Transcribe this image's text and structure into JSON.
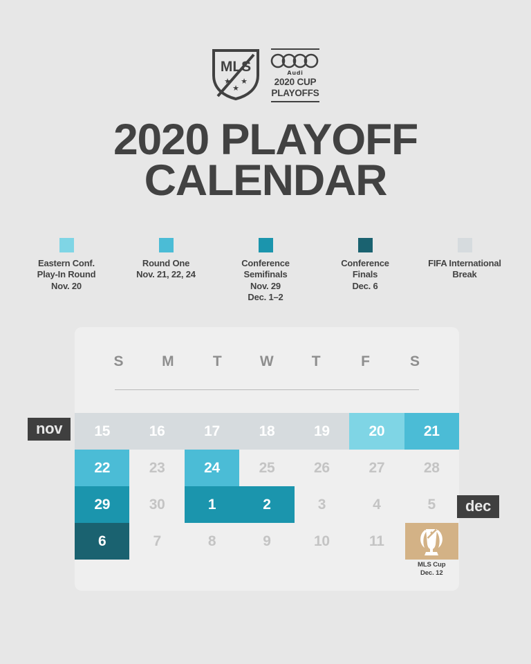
{
  "logo": {
    "shield_text": "MLS",
    "audi_word": "Audi",
    "audi_line1": "2020 CUP",
    "audi_line2": "PLAYOFFS"
  },
  "title": {
    "line1": "2020 PLAYOFF",
    "line2": "CALENDAR"
  },
  "legend": {
    "items": [
      {
        "title": "Eastern Conf.\nPlay-In Round",
        "dates": "Nov. 20",
        "color": "#7fd5e5"
      },
      {
        "title": "Round One",
        "dates": "Nov. 21, 22, 24",
        "color": "#4bbcd6"
      },
      {
        "title": "Conference\nSemifinals",
        "dates": "Nov. 29\nDec. 1–2",
        "color": "#1b95ad"
      },
      {
        "title": "Conference\nFinals",
        "dates": "Dec. 6",
        "color": "#1a6270"
      },
      {
        "title": "FIFA International\nBreak",
        "dates": "",
        "color": "#d6dbde"
      }
    ]
  },
  "calendar": {
    "dow": [
      "S",
      "M",
      "T",
      "W",
      "T",
      "F",
      "S"
    ],
    "month_tags": {
      "nov": "nov",
      "dec": "dec"
    },
    "weeks": [
      [
        {
          "num": "15",
          "type": "fifa"
        },
        {
          "num": "16",
          "type": "fifa"
        },
        {
          "num": "17",
          "type": "fifa"
        },
        {
          "num": "18",
          "type": "fifa"
        },
        {
          "num": "19",
          "type": "fifa"
        },
        {
          "num": "20",
          "type": "playin"
        },
        {
          "num": "21",
          "type": "round1"
        }
      ],
      [
        {
          "num": "22",
          "type": "round1"
        },
        {
          "num": "23",
          "type": "off"
        },
        {
          "num": "24",
          "type": "round1"
        },
        {
          "num": "25",
          "type": "off"
        },
        {
          "num": "26",
          "type": "off"
        },
        {
          "num": "27",
          "type": "off"
        },
        {
          "num": "28",
          "type": "off"
        }
      ],
      [
        {
          "num": "29",
          "type": "semis"
        },
        {
          "num": "30",
          "type": "off"
        },
        {
          "num": "1",
          "type": "semis"
        },
        {
          "num": "2",
          "type": "semis"
        },
        {
          "num": "3",
          "type": "off"
        },
        {
          "num": "4",
          "type": "off"
        },
        {
          "num": "5",
          "type": "off"
        }
      ],
      [
        {
          "num": "6",
          "type": "finals"
        },
        {
          "num": "7",
          "type": "off"
        },
        {
          "num": "8",
          "type": "off"
        },
        {
          "num": "9",
          "type": "off"
        },
        {
          "num": "10",
          "type": "off"
        },
        {
          "num": "11",
          "type": "off"
        },
        {
          "num": "",
          "type": "cup"
        }
      ]
    ],
    "cup": {
      "label": "MLS Cup",
      "date": "Dec. 12",
      "color": "#d3b286"
    }
  },
  "colors": {
    "page_bg": "#e7e7e7",
    "panel_bg": "#efefef",
    "ink": "#424242",
    "playin": "#7fd5e5",
    "round1": "#4bbcd6",
    "semis": "#1b95ad",
    "finals": "#1a6270",
    "fifa": "#d6dbde",
    "cup": "#d3b286"
  }
}
